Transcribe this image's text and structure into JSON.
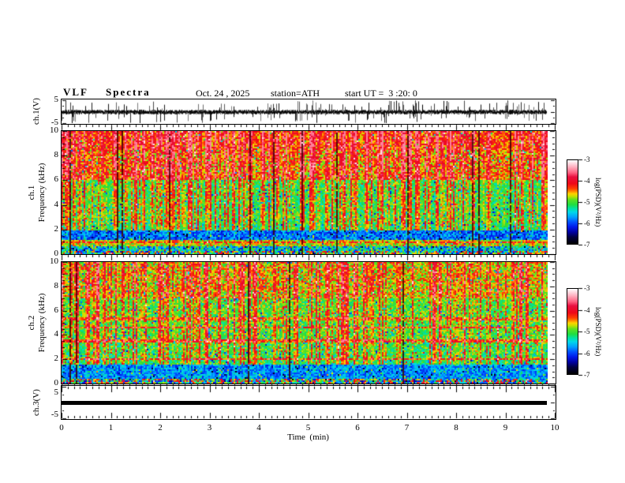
{
  "header": {
    "title": "VLF  Spectra",
    "date": "Oct. 24 , 2025",
    "station": "station=ATH",
    "start_ut": "start UT =  3 :20: 0"
  },
  "x_axis": {
    "label": "Time  (min)",
    "ticks": [
      "0",
      "1",
      "2",
      "3",
      "4",
      "5",
      "6",
      "7",
      "8",
      "9",
      "10"
    ]
  },
  "colorbar": {
    "label": "log(PSD)(V²/Hz)",
    "ticks": [
      "-3",
      "-4",
      "-5",
      "-6",
      "-7"
    ],
    "stops": [
      {
        "t": 0.0,
        "c": "#000000"
      },
      {
        "t": 0.08,
        "c": "#000040"
      },
      {
        "t": 0.14,
        "c": "#0000a0"
      },
      {
        "t": 0.2,
        "c": "#0018e8"
      },
      {
        "t": 0.26,
        "c": "#0050ff"
      },
      {
        "t": 0.32,
        "c": "#00a0ff"
      },
      {
        "t": 0.38,
        "c": "#00d8e8"
      },
      {
        "t": 0.42,
        "c": "#00e0a8"
      },
      {
        "t": 0.47,
        "c": "#20dd40"
      },
      {
        "t": 0.53,
        "c": "#60e020"
      },
      {
        "t": 0.57,
        "c": "#c8e000"
      },
      {
        "t": 0.6,
        "c": "#ffd000"
      },
      {
        "t": 0.63,
        "c": "#ff8000"
      },
      {
        "t": 0.66,
        "c": "#ff4000"
      },
      {
        "t": 0.72,
        "c": "#ee0818"
      },
      {
        "t": 0.8,
        "c": "#e81040"
      },
      {
        "t": 0.85,
        "c": "#ff6080"
      },
      {
        "t": 0.92,
        "c": "#ffb0c0"
      },
      {
        "t": 1.0,
        "c": "#ffffff"
      }
    ]
  },
  "panels": {
    "ch1_wave": {
      "ylabel": "ch.1(V)",
      "yticks": [
        "5",
        "-5"
      ]
    },
    "ch1_spec": {
      "ylabel_ch": "ch.1",
      "ylabel_axis": "Frequency  (kHz)",
      "yticks": [
        "10",
        "8",
        "6",
        "4",
        "2",
        "0"
      ]
    },
    "ch2_spec": {
      "ylabel_ch": "ch.2",
      "ylabel_axis": "Frequency  (kHz)",
      "yticks": [
        "10",
        "8",
        "6",
        "4",
        "2",
        "0"
      ]
    },
    "ch3_wave": {
      "ylabel": "ch.3(V)",
      "yticks": [
        "5",
        "-5"
      ]
    }
  },
  "chart_data": [
    {
      "type": "line",
      "panel": "ch.1 waveform",
      "ylabel": "ch.1(V)",
      "ylim": [
        -5,
        5
      ],
      "xlim": [
        0,
        10
      ],
      "xlabel": "Time (min)",
      "summary": "Dense broadband noise waveform centered near 0 V with frequent impulsive spikes reaching +/-5 V over the full 0-9.8 min record",
      "data_end_min": 9.83,
      "seed": 7
    },
    {
      "type": "heatmap",
      "panel": "ch.1 spectrogram",
      "ylabel": "ch.1 Frequency (kHz)",
      "ylim": [
        0,
        10
      ],
      "xlim": [
        0,
        10
      ],
      "colorbar": {
        "label": "log(PSD)(V²/Hz)",
        "min": -7,
        "max": -3
      },
      "summary": "VLF spectrogram: dense red/orange sferic vertical streaks above ~2 kHz on a green background, hottest (red) above 6 kHz; quiet blue speckled band 1.1-1.9 kHz; bright yellow-green band 0.6-1.1 kHz; dark noisy speckle below 0.3 kHz; data ends at ~9.8 min",
      "data_end_min": 9.83,
      "seed": 101,
      "bands": [
        {
          "f": [
            8.5,
            10.01
          ],
          "base": 0.66,
          "noise": 0.1
        },
        {
          "f": [
            6.0,
            8.5
          ],
          "base": 0.62,
          "noise": 0.11
        },
        {
          "f": [
            2.5,
            6.0
          ],
          "base": 0.475,
          "noise": 0.09
        },
        {
          "f": [
            1.9,
            2.5
          ],
          "base": 0.44,
          "noise": 0.09
        },
        {
          "f": [
            1.1,
            1.9
          ],
          "base": 0.27,
          "noise": 0.1
        },
        {
          "f": [
            0.6,
            1.1
          ],
          "base": 0.55,
          "noise": 0.1
        },
        {
          "f": [
            0.3,
            0.6
          ],
          "base": 0.36,
          "noise": 0.18
        },
        {
          "f": [
            0.0,
            0.3
          ],
          "base": 0.45,
          "noise": 0.3
        }
      ],
      "lines": [
        {
          "f": 0.95,
          "boost": 0.1
        }
      ],
      "streaks": {
        "strong_p": 0.32,
        "weak_p": 0.26,
        "dark_p": 0.06,
        "boost": 0.26,
        "min_f": 1.9
      }
    },
    {
      "type": "heatmap",
      "panel": "ch.2 spectrogram",
      "ylabel": "ch.2 Frequency (kHz)",
      "ylim": [
        0,
        10
      ],
      "xlim": [
        0,
        10
      ],
      "colorbar": {
        "label": "log(PSD)(V²/Hz)",
        "min": -7,
        "max": -3
      },
      "summary": "VLF spectrogram: green background with red sferic streaks above ~2 kHz; faint orange horizontal interference lines near 2.05, 3.5, 4.65 and 5.3 kHz; cyan-blue quiet band 0.45-1.55 kHz; noisy speckle below 0.45 kHz; data ends at ~9.8 min",
      "data_end_min": 9.83,
      "seed": 202,
      "bands": [
        {
          "f": [
            7.0,
            10.01
          ],
          "base": 0.58,
          "noise": 0.11
        },
        {
          "f": [
            3.5,
            7.0
          ],
          "base": 0.5,
          "noise": 0.09
        },
        {
          "f": [
            1.95,
            3.5
          ],
          "base": 0.48,
          "noise": 0.1
        },
        {
          "f": [
            1.55,
            1.95
          ],
          "base": 0.46,
          "noise": 0.08
        },
        {
          "f": [
            0.45,
            1.55
          ],
          "base": 0.3,
          "noise": 0.1
        },
        {
          "f": [
            0.0,
            0.45
          ],
          "base": 0.46,
          "noise": 0.32
        }
      ],
      "lines": [
        {
          "f": 2.05,
          "boost": 0.18
        },
        {
          "f": 3.5,
          "boost": 0.16
        },
        {
          "f": 4.65,
          "boost": 0.14
        },
        {
          "f": 5.3,
          "boost": 0.12
        }
      ],
      "streaks": {
        "strong_p": 0.26,
        "weak_p": 0.24,
        "dark_p": 0.05,
        "boost": 0.26,
        "min_f": 1.55
      }
    },
    {
      "type": "line",
      "panel": "ch.3 waveform",
      "ylabel": "ch.3(V)",
      "ylim": [
        -5,
        5
      ],
      "xlim": [
        0,
        10
      ],
      "xlabel": "Time (min)",
      "summary": "Constant flat thick black line at 0 V from 0 to ~9.8 min (no signal)",
      "data_end_min": 9.83,
      "values_constant": 0
    }
  ]
}
